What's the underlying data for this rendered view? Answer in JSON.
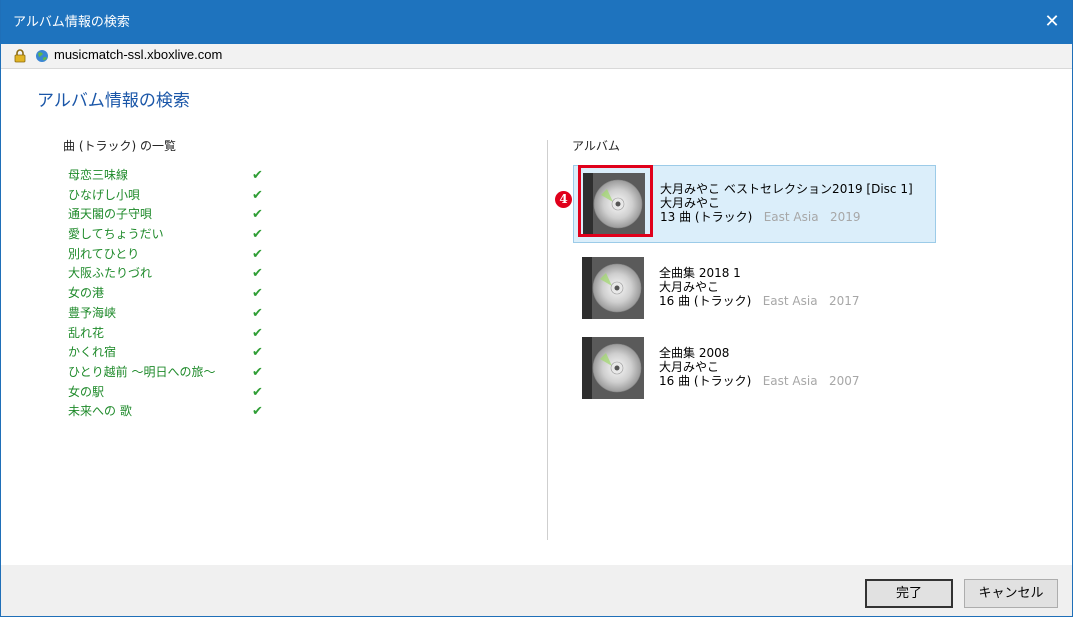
{
  "window": {
    "title": "アルバム情報の検索",
    "close_glyph": "✕"
  },
  "address": {
    "url": "musicmatch-ssl.xboxlive.com"
  },
  "page": {
    "heading": "アルバム情報の検索"
  },
  "tracks": {
    "header": "曲 (トラック) の一覧",
    "check_glyph": "✔",
    "items": [
      "母恋三味線",
      "ひなげし小唄",
      "通天閣の子守唄",
      "愛してちょうだい",
      "別れてひとり",
      "大阪ふたりづれ",
      "女の港",
      "豊予海峡",
      "乱れ花",
      "かくれ宿",
      "ひとり越前 〜明日への旅〜",
      "女の駅",
      "未来への 歌"
    ]
  },
  "albums": {
    "header": "アルバム",
    "items": [
      {
        "title": "大月みやこ ベストセレクション2019 [Disc 1]",
        "artist": "大月みやこ",
        "tracks": "13 曲 (トラック)",
        "region": "East Asia",
        "year": "2019",
        "selected": true
      },
      {
        "title": "全曲集 2018 1",
        "artist": "大月みやこ",
        "tracks": "16 曲 (トラック)",
        "region": "East Asia",
        "year": "2017",
        "selected": false
      },
      {
        "title": "全曲集 2008",
        "artist": "大月みやこ",
        "tracks": "16 曲 (トラック)",
        "region": "East Asia",
        "year": "2007",
        "selected": false
      }
    ]
  },
  "annotation": {
    "step_number": "4",
    "color": "#e0001b"
  },
  "buttons": {
    "done": "完了",
    "cancel": "キャンセル"
  },
  "colors": {
    "titlebar": "#1e73be",
    "heading": "#1a56a8",
    "track_text": "#1e8a2a",
    "selected_bg": "#dbeefa"
  }
}
